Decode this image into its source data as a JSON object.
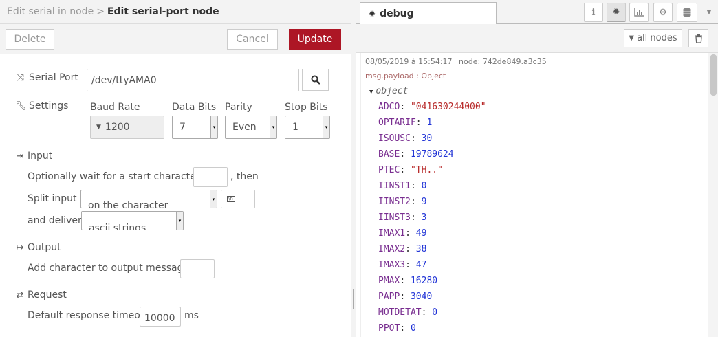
{
  "tray": {
    "breadcrumb": {
      "parent": "Edit serial in node",
      "separator": ">",
      "current": "Edit serial-port node"
    },
    "buttons": {
      "delete": "Delete",
      "cancel": "Cancel",
      "update": "Update"
    },
    "colors": {
      "primary": "#ad1625"
    },
    "serial_port": {
      "label": "Serial Port",
      "value": "/dev/ttyAMA0",
      "lookup_icon": "search-icon"
    },
    "settings": {
      "label": "Settings",
      "baud_rate": {
        "label": "Baud Rate",
        "value": "1200"
      },
      "data_bits": {
        "label": "Data Bits",
        "value": "7"
      },
      "parity": {
        "label": "Parity",
        "value": "Even"
      },
      "stop_bits": {
        "label": "Stop Bits",
        "value": "1"
      }
    },
    "input": {
      "label": "Input",
      "wait_text": "Optionally wait for a start character of",
      "wait_suffix": ", then",
      "split_label": "Split input",
      "split_value": "on the character",
      "split_char": "\\n",
      "deliver_label": "and deliver",
      "deliver_value": "ascii strings"
    },
    "output": {
      "label": "Output",
      "add_char_text": "Add character to output messages"
    },
    "request": {
      "label": "Request",
      "timeout_text": "Default response timeout",
      "timeout_value": "10000",
      "timeout_unit": "ms"
    }
  },
  "sidebar": {
    "tab_label": "debug",
    "tab_icons": [
      "info-icon",
      "bug-icon",
      "chart-icon",
      "gear-icon",
      "database-icon",
      "chevron-down-icon"
    ],
    "filter_label": "all nodes",
    "message": {
      "timestamp": "08/05/2019 à 15:54:17",
      "node": "node: 742de849.a3c35",
      "topic": "msg.payload : Object",
      "object_label": "object",
      "properties": [
        {
          "key": "ADCO",
          "value": "\"041630244000\"",
          "type": "str"
        },
        {
          "key": "OPTARIF",
          "value": "1",
          "type": "num"
        },
        {
          "key": "ISOUSC",
          "value": "30",
          "type": "num"
        },
        {
          "key": "BASE",
          "value": "19789624",
          "type": "num"
        },
        {
          "key": "PTEC",
          "value": "\"TH..\"",
          "type": "str"
        },
        {
          "key": "IINST1",
          "value": "0",
          "type": "num"
        },
        {
          "key": "IINST2",
          "value": "9",
          "type": "num"
        },
        {
          "key": "IINST3",
          "value": "3",
          "type": "num"
        },
        {
          "key": "IMAX1",
          "value": "49",
          "type": "num"
        },
        {
          "key": "IMAX2",
          "value": "38",
          "type": "num"
        },
        {
          "key": "IMAX3",
          "value": "47",
          "type": "num"
        },
        {
          "key": "PMAX",
          "value": "16280",
          "type": "num"
        },
        {
          "key": "PAPP",
          "value": "3040",
          "type": "num"
        },
        {
          "key": "MOTDETAT",
          "value": "0",
          "type": "num"
        },
        {
          "key": "PPOT",
          "value": "0",
          "type": "num"
        }
      ]
    }
  }
}
